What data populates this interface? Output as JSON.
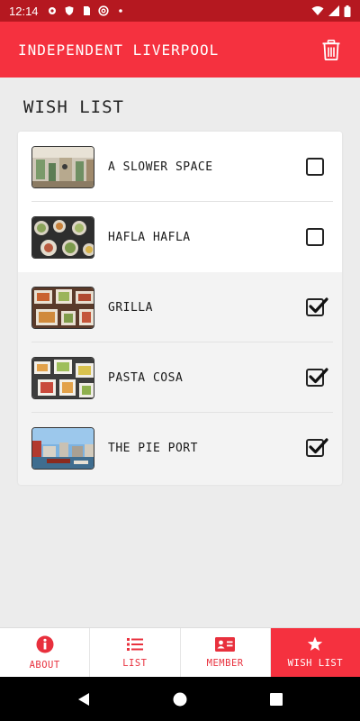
{
  "status_bar": {
    "time": "12:14",
    "left_icons": [
      "gear-icon",
      "shield-icon",
      "sim-card-icon",
      "at-sign-icon",
      "dot-icon"
    ],
    "right_icons": [
      "wifi-icon",
      "signal-icon",
      "battery-icon"
    ]
  },
  "app_bar": {
    "title": "INDEPENDENT LIVERPOOL",
    "trash_icon": "trash-icon"
  },
  "page": {
    "title": "WISH LIST"
  },
  "wish_list": {
    "items": [
      {
        "label": "A SLOWER SPACE",
        "checked": false
      },
      {
        "label": "HAFLA HAFLA",
        "checked": false
      },
      {
        "label": "GRILLA",
        "checked": true
      },
      {
        "label": "PASTA COSA",
        "checked": true
      },
      {
        "label": "THE PIE PORT",
        "checked": true
      }
    ]
  },
  "bottom_nav": {
    "tabs": [
      {
        "label": "ABOUT",
        "icon": "info-icon",
        "active": false
      },
      {
        "label": "LIST",
        "icon": "list-icon",
        "active": false
      },
      {
        "label": "MEMBER",
        "icon": "member-card-icon",
        "active": false
      },
      {
        "label": "WISH LIST",
        "icon": "star-icon",
        "active": true
      }
    ]
  },
  "colors": {
    "accent": "#f5313f",
    "status_bar": "#b51820",
    "text": "#1a1a1a"
  }
}
